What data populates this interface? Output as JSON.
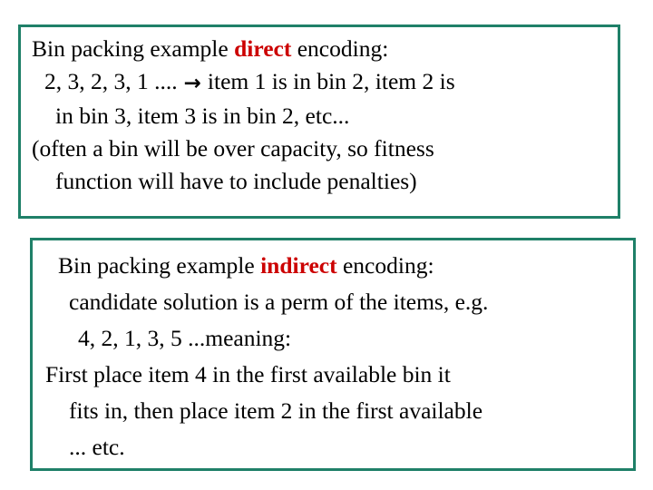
{
  "slide": {
    "background_color": "#ffffff",
    "border_color": "#1f8068",
    "accent_color": "#cc0000",
    "text_color": "#000000"
  },
  "box_direct": {
    "heading": {
      "before": "Bin packing  example ",
      "emphasis": "direct",
      "after": " encoding:"
    },
    "lines": [
      {
        "before": "2, 3, 2, 3, 1 ....",
        "arrow": "→",
        "after": "item 1 is in bin 2, item 2 is"
      },
      {
        "text": "in bin 3, item 3 is in bin 2, etc..."
      },
      {
        "text": "(often a bin will be over capacity, so  fitness"
      },
      {
        "text": "function will have to include penalties)"
      }
    ]
  },
  "box_indirect": {
    "heading": {
      "before": "Bin packing  example ",
      "emphasis": "indirect",
      "after": " encoding:"
    },
    "lines": [
      {
        "text": "candidate solution is a perm of the items, e.g."
      },
      {
        "text": "4, 2, 1, 3, 5  ...meaning:"
      },
      {
        "text": "First place item 4 in the first available bin it"
      },
      {
        "text": "fits in, then place item 2 in the first available"
      },
      {
        "text": "... etc."
      }
    ]
  }
}
